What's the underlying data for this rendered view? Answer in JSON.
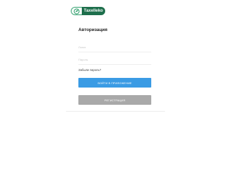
{
  "logo": {
    "text": "Taxelleko",
    "mark_icon": "leaf-circle-icon",
    "brand_color": "#1e6f4c"
  },
  "auth": {
    "title": "Авторизация",
    "login_placeholder": "Логин",
    "password_placeholder": "Пароль",
    "forgot_password": "Забыли пароль?",
    "login_button": "Войти в приложение",
    "register_button": "Регистрация"
  },
  "colors": {
    "primary_button": "#3a9be4",
    "secondary_button": "#a9a9a9"
  }
}
